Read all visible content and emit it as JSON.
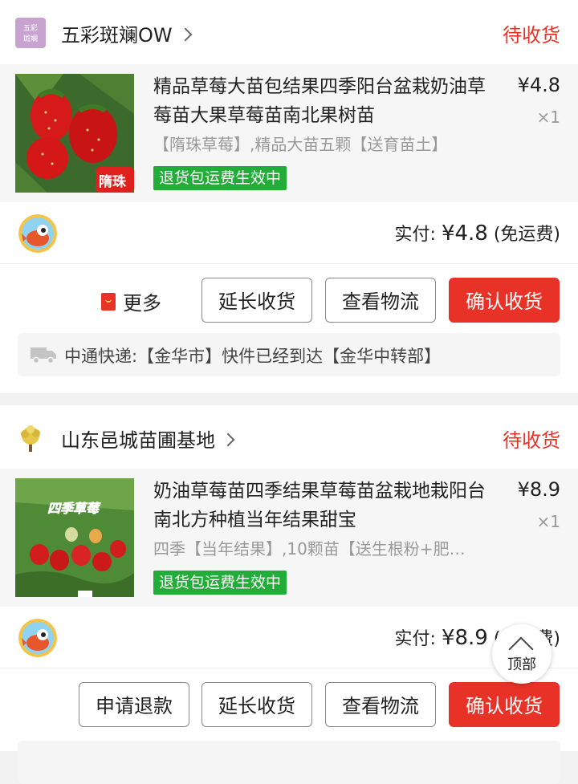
{
  "orders": [
    {
      "shop": {
        "name": "五彩斑斓OW",
        "logo_text": "五彩斑斓"
      },
      "status": "待收货",
      "item": {
        "title": "精品草莓大苗包结果四季阳台盆栽奶油草莓苗大果草莓苗南北果树苗",
        "price": "¥4.8",
        "qty": "×1",
        "spec": "【隋珠草莓】,精品大苗五颗【送育苗土】",
        "badge": "隋珠",
        "return_tag": "退货包运费生效中"
      },
      "payment": {
        "label": "实付:",
        "amount": "¥4.8",
        "note": "(免运费)"
      },
      "actions": {
        "more": "更多",
        "extend": "延长收货",
        "logistics": "查看物流",
        "confirm": "确认收货"
      },
      "logistics_info": "中通快递:【金华市】快件已经到达【金华中转部】"
    },
    {
      "shop": {
        "name": "山东邑城苗圃基地"
      },
      "status": "待收货",
      "item": {
        "title": "奶油草莓苗四季结果草莓苗盆栽地栽阳台南北方种植当年结果甜宝",
        "price": "¥8.9",
        "qty": "×1",
        "spec": "四季【当年结果】,10颗苗【送生根粉+肥…",
        "badge": "四季草莓",
        "return_tag": "退货包运费生效中"
      },
      "payment": {
        "label": "实付:",
        "amount": "¥8.9",
        "note": "(免运费)"
      },
      "actions": {
        "refund": "申请退款",
        "extend": "延长收货",
        "logistics": "查看物流",
        "confirm": "确认收货"
      }
    }
  ],
  "top_button": {
    "label": "顶部"
  },
  "colors": {
    "accent": "#e83228",
    "green_tag": "#22ac38",
    "page_bg": "#f2f2f2"
  }
}
